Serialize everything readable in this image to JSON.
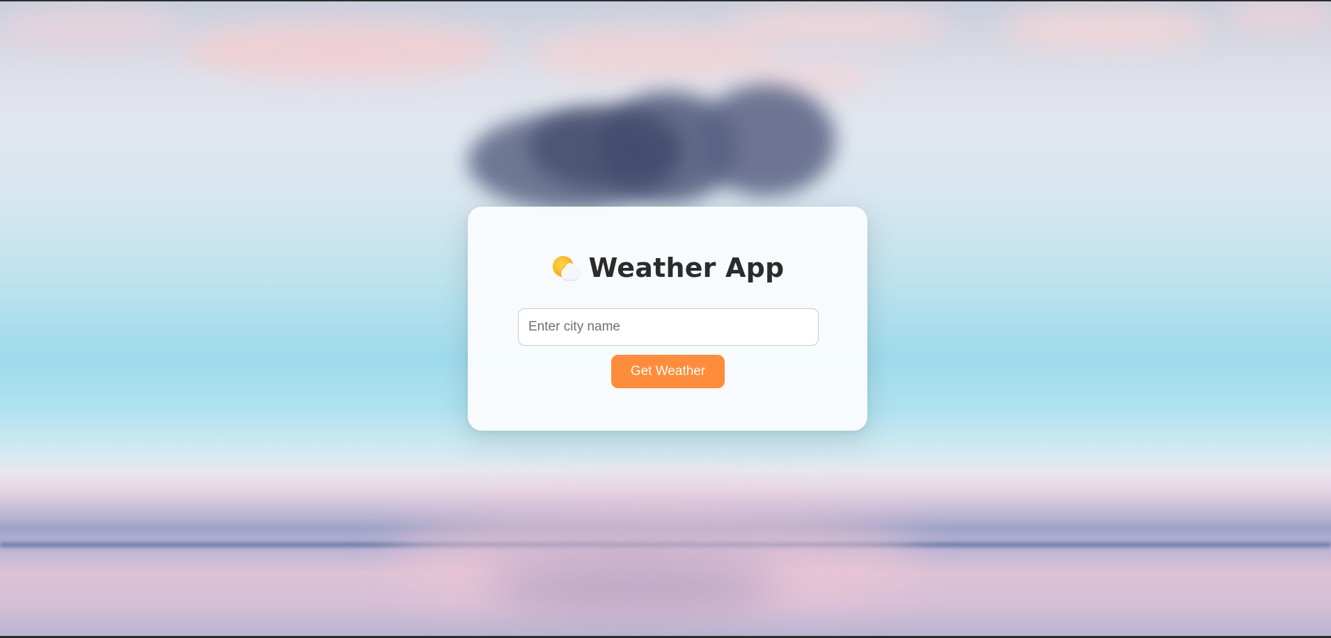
{
  "app": {
    "title": "Weather App",
    "title_icon": "sun-behind-cloud-icon"
  },
  "search": {
    "placeholder": "Enter city name",
    "value": ""
  },
  "actions": {
    "get_weather_label": "Get Weather"
  },
  "colors": {
    "button_bg": "#ff8c3a",
    "title_text": "#2b2b2b",
    "card_bg": "#fafcfd"
  }
}
